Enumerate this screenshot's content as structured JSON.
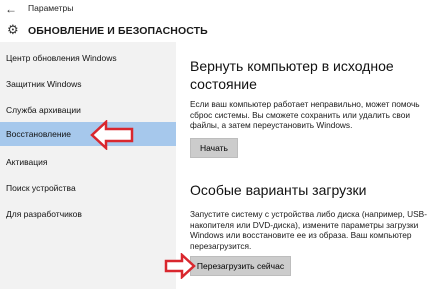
{
  "titlebar": {
    "back_icon": "arrow-left-icon",
    "title": "Параметры"
  },
  "header": {
    "icon": "gear-icon",
    "title": "ОБНОВЛЕНИЕ И БЕЗОПАСНОСТЬ"
  },
  "sidebar": {
    "items": [
      {
        "label": "Центр обновления Windows",
        "active": false
      },
      {
        "label": "Защитник Windows",
        "active": false
      },
      {
        "label": "Служба архивации",
        "active": false
      },
      {
        "label": "Восстановление",
        "active": true
      },
      {
        "label": "Активация",
        "active": false
      },
      {
        "label": "Поиск устройства",
        "active": false
      },
      {
        "label": "Для разработчиков",
        "active": false
      }
    ]
  },
  "reset": {
    "title": "Вернуть компьютер в исходное состояние",
    "description": "Если ваш компьютер работает неправильно, может помочь сброс системы. Вы сможете сохранить или удалить свои файлы, а затем переустановить Windows.",
    "button": "Начать"
  },
  "advanced": {
    "title": "Особые варианты загрузки",
    "description": "Запустите систему с устройства либо диска (например, USB-накопителя или DVD-диска), измените параметры загрузки Windows или восстановите ее из образа. Ваш компьютер перезагрузится.",
    "button": "Перезагрузить сейчас"
  },
  "colors": {
    "sidebar_bg": "#f2f2f2",
    "active_bg": "#a6c8ec",
    "button_bg": "#cccccc",
    "annotation_arrow": "#d9272e"
  }
}
